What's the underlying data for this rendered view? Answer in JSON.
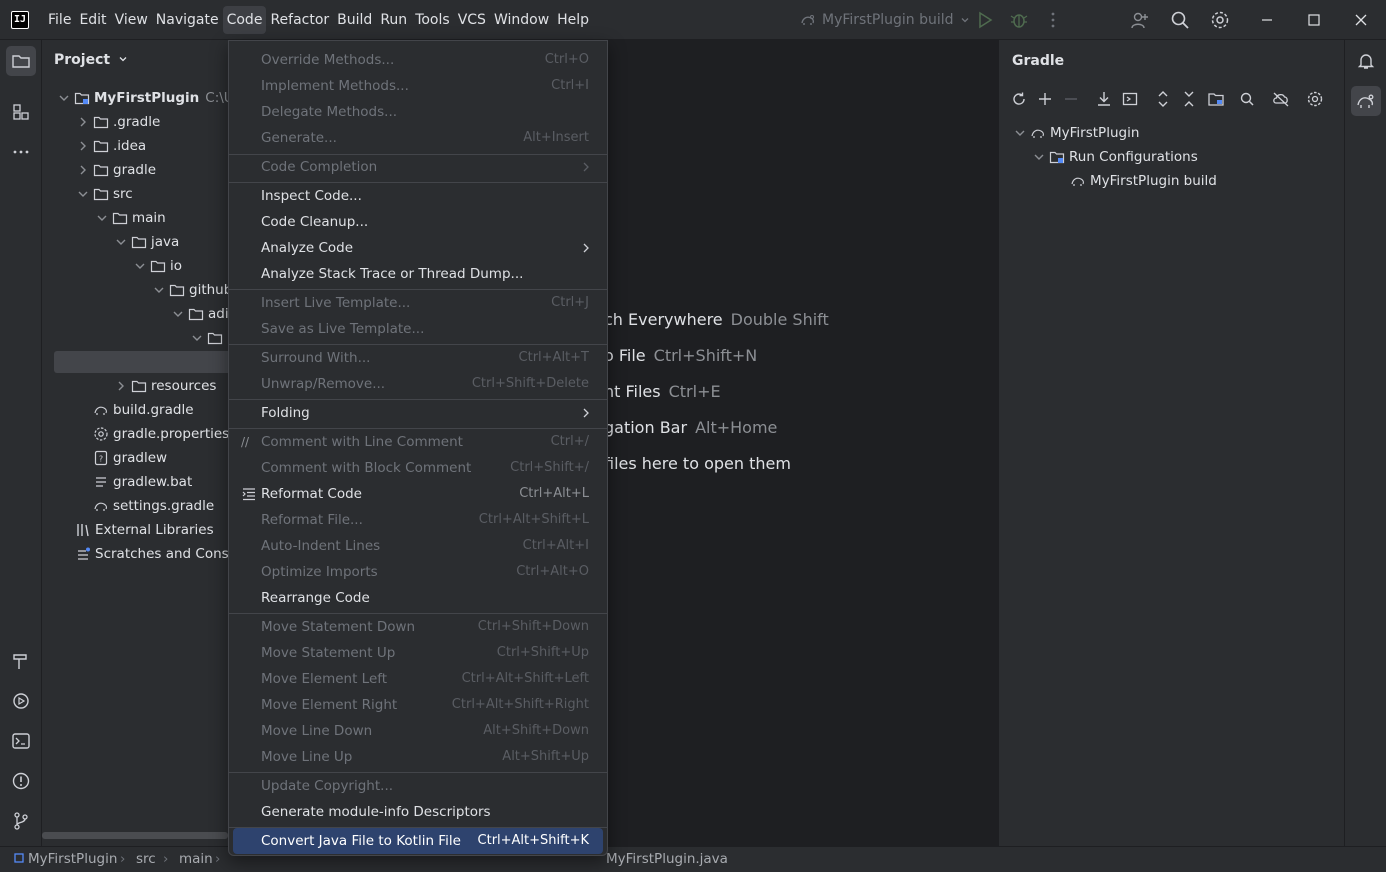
{
  "titlebar": {
    "menus": [
      "File",
      "Edit",
      "View",
      "Navigate",
      "Code",
      "Refactor",
      "Build",
      "Run",
      "Tools",
      "VCS",
      "Window",
      "Help"
    ],
    "active_menu": "Code",
    "run_config": "MyFirstPlugin build"
  },
  "project_panel": {
    "title": "Project",
    "tree": [
      {
        "label": "MyFirstPlugin",
        "sub": "C:\\Use"
      },
      {
        "label": ".gradle"
      },
      {
        "label": ".idea"
      },
      {
        "label": "gradle"
      },
      {
        "label": "src"
      },
      {
        "label": "main"
      },
      {
        "label": "java"
      },
      {
        "label": "io"
      },
      {
        "label": "github"
      },
      {
        "label": "adi"
      },
      {
        "label": ""
      },
      {
        "label": ""
      },
      {
        "label": "resources"
      },
      {
        "label": "build.gradle"
      },
      {
        "label": "gradle.properties"
      },
      {
        "label": "gradlew"
      },
      {
        "label": "gradlew.bat"
      },
      {
        "label": "settings.gradle"
      },
      {
        "label": "External Libraries"
      },
      {
        "label": "Scratches and Conso"
      }
    ]
  },
  "editor_hints": [
    {
      "text": "ch Everywhere",
      "key": "Double Shift"
    },
    {
      "text": "o File",
      "key": "Ctrl+Shift+N"
    },
    {
      "text": "nt Files",
      "key": "Ctrl+E"
    },
    {
      "text": "gation Bar",
      "key": "Alt+Home"
    },
    {
      "text": " files here to open them",
      "key": ""
    }
  ],
  "code_menu": {
    "items": [
      {
        "label": "Override Methods...",
        "shortcut": "Ctrl+O",
        "disabled": true
      },
      {
        "label": "Implement Methods...",
        "shortcut": "Ctrl+I",
        "disabled": true
      },
      {
        "label": "Delegate Methods...",
        "shortcut": "",
        "disabled": true
      },
      {
        "label": "Generate...",
        "shortcut": "Alt+Insert",
        "disabled": true
      },
      {
        "label": "Code Completion",
        "shortcut": "",
        "disabled": true
      },
      {
        "label": "Inspect Code...",
        "shortcut": "",
        "disabled": false
      },
      {
        "label": "Code Cleanup...",
        "shortcut": "",
        "disabled": false
      },
      {
        "label": "Analyze Code",
        "shortcut": "",
        "disabled": false
      },
      {
        "label": "Analyze Stack Trace or Thread Dump...",
        "shortcut": "",
        "disabled": false
      },
      {
        "label": "Insert Live Template...",
        "shortcut": "Ctrl+J",
        "disabled": true
      },
      {
        "label": "Save as Live Template...",
        "shortcut": "",
        "disabled": true
      },
      {
        "label": "Surround With...",
        "shortcut": "Ctrl+Alt+T",
        "disabled": true
      },
      {
        "label": "Unwrap/Remove...",
        "shortcut": "Ctrl+Shift+Delete",
        "disabled": true
      },
      {
        "label": "Folding",
        "shortcut": "",
        "disabled": false
      },
      {
        "label": "Comment with Line Comment",
        "shortcut": "Ctrl+/",
        "disabled": true
      },
      {
        "label": "Comment with Block Comment",
        "shortcut": "Ctrl+Shift+/",
        "disabled": true
      },
      {
        "label": "Reformat Code",
        "shortcut": "Ctrl+Alt+L",
        "disabled": false
      },
      {
        "label": "Reformat File...",
        "shortcut": "Ctrl+Alt+Shift+L",
        "disabled": true
      },
      {
        "label": "Auto-Indent Lines",
        "shortcut": "Ctrl+Alt+I",
        "disabled": true
      },
      {
        "label": "Optimize Imports",
        "shortcut": "Ctrl+Alt+O",
        "disabled": true
      },
      {
        "label": "Rearrange Code",
        "shortcut": "",
        "disabled": false
      },
      {
        "label": "Move Statement Down",
        "shortcut": "Ctrl+Shift+Down",
        "disabled": true
      },
      {
        "label": "Move Statement Up",
        "shortcut": "Ctrl+Shift+Up",
        "disabled": true
      },
      {
        "label": "Move Element Left",
        "shortcut": "Ctrl+Alt+Shift+Left",
        "disabled": true
      },
      {
        "label": "Move Element Right",
        "shortcut": "Ctrl+Alt+Shift+Right",
        "disabled": true
      },
      {
        "label": "Move Line Down",
        "shortcut": "Alt+Shift+Down",
        "disabled": true
      },
      {
        "label": "Move Line Up",
        "shortcut": "Alt+Shift+Up",
        "disabled": true
      },
      {
        "label": "Update Copyright...",
        "shortcut": "",
        "disabled": true
      },
      {
        "label": "Generate module-info Descriptors",
        "shortcut": "",
        "disabled": false
      },
      {
        "label": "Convert Java File to Kotlin File",
        "shortcut": "Ctrl+Alt+Shift+K",
        "disabled": false,
        "highlighted": true
      }
    ]
  },
  "gradle_panel": {
    "title": "Gradle",
    "tree": [
      {
        "label": "MyFirstPlugin"
      },
      {
        "label": "Run Configurations"
      },
      {
        "label": "MyFirstPlugin build"
      }
    ]
  },
  "statusbar": {
    "breadcrumbs": [
      "MyFirstPlugin",
      "src",
      "main"
    ],
    "file": "MyFirstPlugin.java"
  },
  "colors": {
    "background": "#1e1f22",
    "panel": "#2b2d30",
    "highlight": "#2e436e",
    "disabled_text": "#6f737a"
  }
}
